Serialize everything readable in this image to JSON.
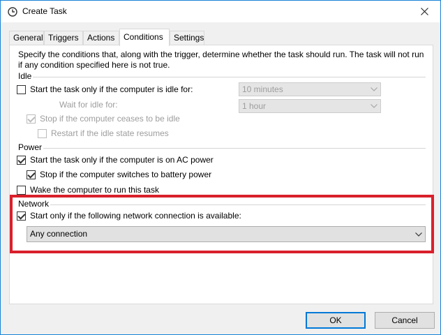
{
  "window": {
    "title": "Create Task"
  },
  "tabs": [
    {
      "label": "General"
    },
    {
      "label": "Triggers"
    },
    {
      "label": "Actions"
    },
    {
      "label": "Conditions"
    },
    {
      "label": "Settings"
    }
  ],
  "active_tab": "Conditions",
  "description": "Specify the conditions that, along with the trigger, determine whether the task should run.  The task will not run  if any condition specified here is not true.",
  "idle": {
    "group_label": "Idle",
    "start_if_idle": {
      "label": "Start the task only if the computer is idle for:",
      "checked": false
    },
    "idle_for_value": "10 minutes",
    "wait_label": "Wait for idle for:",
    "wait_value": "1 hour",
    "stop_if_not_idle": {
      "label": "Stop if the computer ceases to be idle",
      "checked": true,
      "enabled": false
    },
    "restart_if_resumes": {
      "label": "Restart if the idle state resumes",
      "checked": false,
      "enabled": false
    }
  },
  "power": {
    "group_label": "Power",
    "ac_power": {
      "label": "Start the task only if the computer is on AC power",
      "checked": true
    },
    "stop_on_battery": {
      "label": "Stop if the computer switches to battery power",
      "checked": true
    },
    "wake": {
      "label": "Wake the computer to run this task",
      "checked": false
    }
  },
  "network": {
    "group_label": "Network",
    "start_if_network": {
      "label": "Start only if the following network connection is available:",
      "checked": true
    },
    "connection_value": "Any connection"
  },
  "buttons": {
    "ok": "OK",
    "cancel": "Cancel"
  },
  "colors": {
    "highlight": "#d9202c",
    "accent": "#0078d7",
    "window_border": "#1883d7"
  }
}
